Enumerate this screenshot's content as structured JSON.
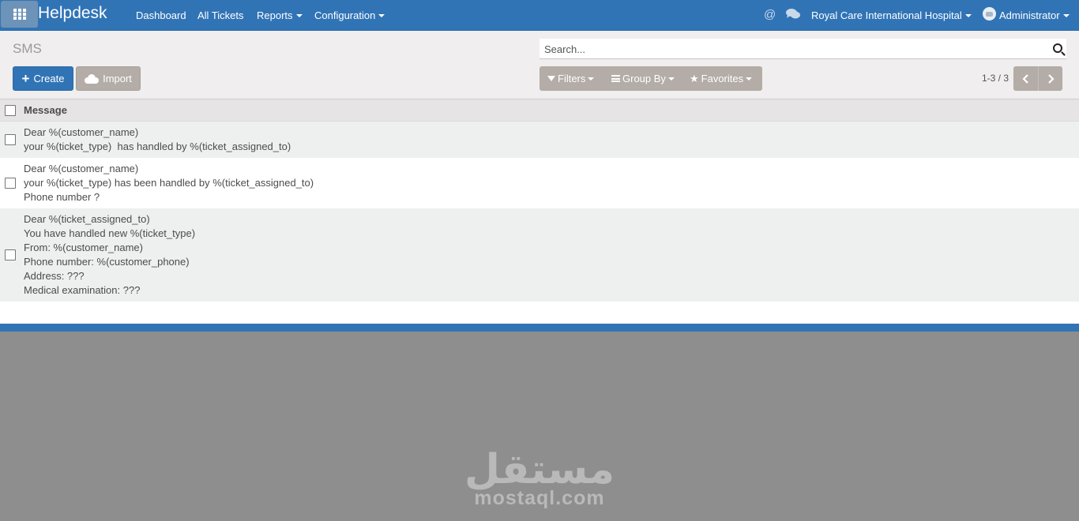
{
  "navbar": {
    "brand": "Helpdesk",
    "menu": [
      {
        "label": "Dashboard"
      },
      {
        "label": "All Tickets"
      },
      {
        "label": "Reports"
      },
      {
        "label": "Configuration"
      }
    ],
    "company": "Royal Care International Hospital",
    "user": "Administrator",
    "icons": [
      "apps-grid-icon",
      "at-sign-icon",
      "chat-bubbles-icon",
      "avatar"
    ],
    "accent_color": "#3174b6"
  },
  "control_panel": {
    "breadcrumb": "SMS",
    "search_placeholder": "Search...",
    "create_label": "Create",
    "import_label": "Import",
    "filters_label": "Filters",
    "groupby_label": "Group By",
    "favorites_label": "Favorites",
    "pager_value": "1-3 / 3"
  },
  "list": {
    "column_header": "Message",
    "rows": [
      {
        "lines": [
          "Dear %(customer_name)",
          "your %(ticket_type)  has handled by %(ticket_assigned_to)"
        ]
      },
      {
        "lines": [
          "Dear %(customer_name)",
          "your %(ticket_type) has been handled by %(ticket_assigned_to)",
          "Phone number ?"
        ]
      },
      {
        "lines": [
          "Dear %(ticket_assigned_to)",
          "You have handled new %(ticket_type)",
          "From: %(customer_name)",
          "Phone number: %(customer_phone)",
          "Address: ???",
          "Medical examination: ???"
        ]
      }
    ]
  },
  "watermark": {
    "arabic": "مستقل",
    "latin": "mostaql.com"
  }
}
